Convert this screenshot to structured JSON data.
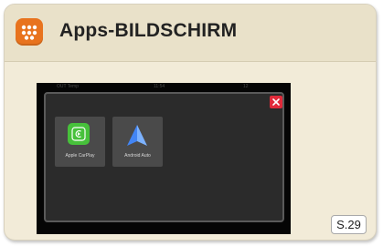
{
  "header": {
    "title": "Apps-BILDSCHIRM",
    "icon": "apps-grid-icon",
    "icon_color": "#e8731e"
  },
  "screen": {
    "status_bar": {
      "left_text": "OUT Temp",
      "center_text": "11:54",
      "right_text": "12"
    },
    "dialog": {
      "close_icon": "close-icon",
      "close_color": "#e02a3a",
      "apps": [
        {
          "label": "Apple CarPlay",
          "icon": "carplay-icon",
          "color": "#47c13b"
        },
        {
          "label": "Android Auto",
          "icon": "android-auto-icon",
          "color": "#4285f4"
        }
      ]
    }
  },
  "page_ref": "S.29"
}
